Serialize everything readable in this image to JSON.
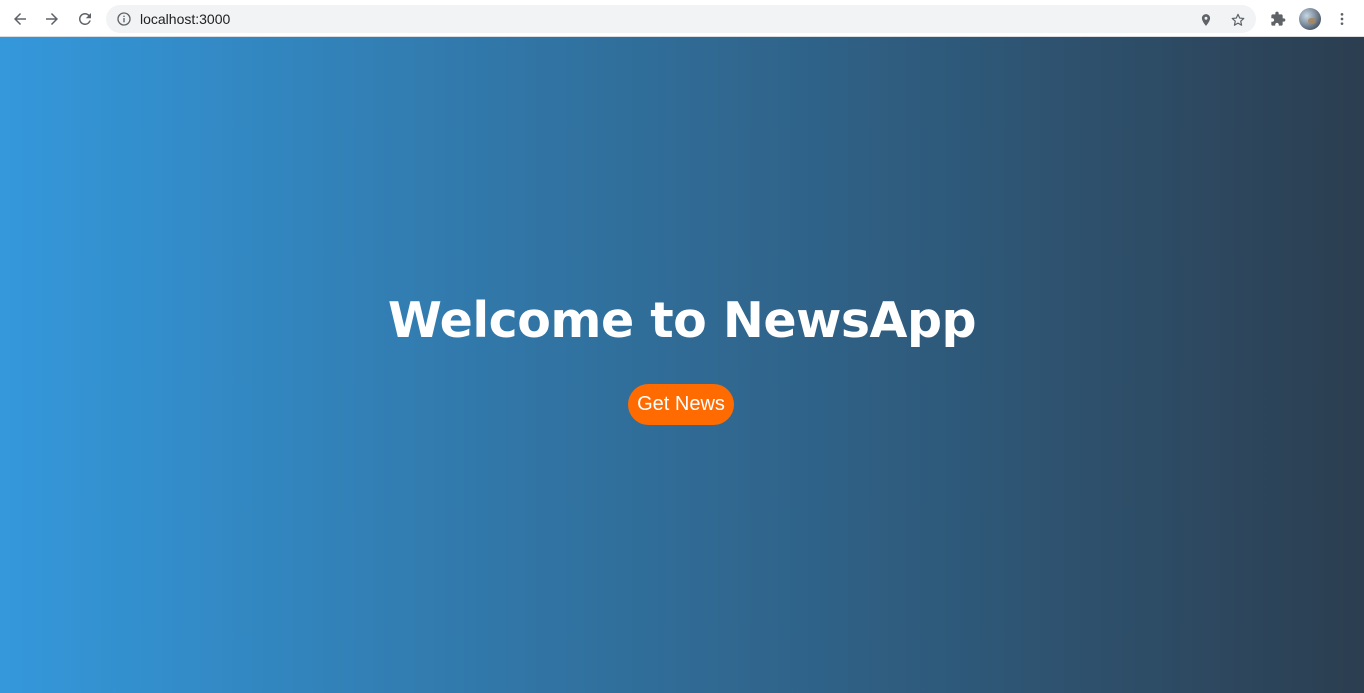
{
  "browser": {
    "url": "localhost:3000",
    "icons": {
      "back": "arrow-left-icon",
      "forward": "arrow-right-icon",
      "reload": "reload-icon",
      "site_info": "info-icon",
      "location": "location-pin-icon",
      "bookmark": "star-icon",
      "extensions": "puzzle-icon",
      "profile": "avatar",
      "menu": "kebab-menu-icon"
    }
  },
  "page": {
    "title": "Welcome to NewsApp",
    "button_label": "Get News",
    "colors": {
      "gradient_start": "#3498db",
      "gradient_end": "#2c3e50",
      "button_bg": "#ff6b00",
      "text": "#ffffff"
    }
  }
}
